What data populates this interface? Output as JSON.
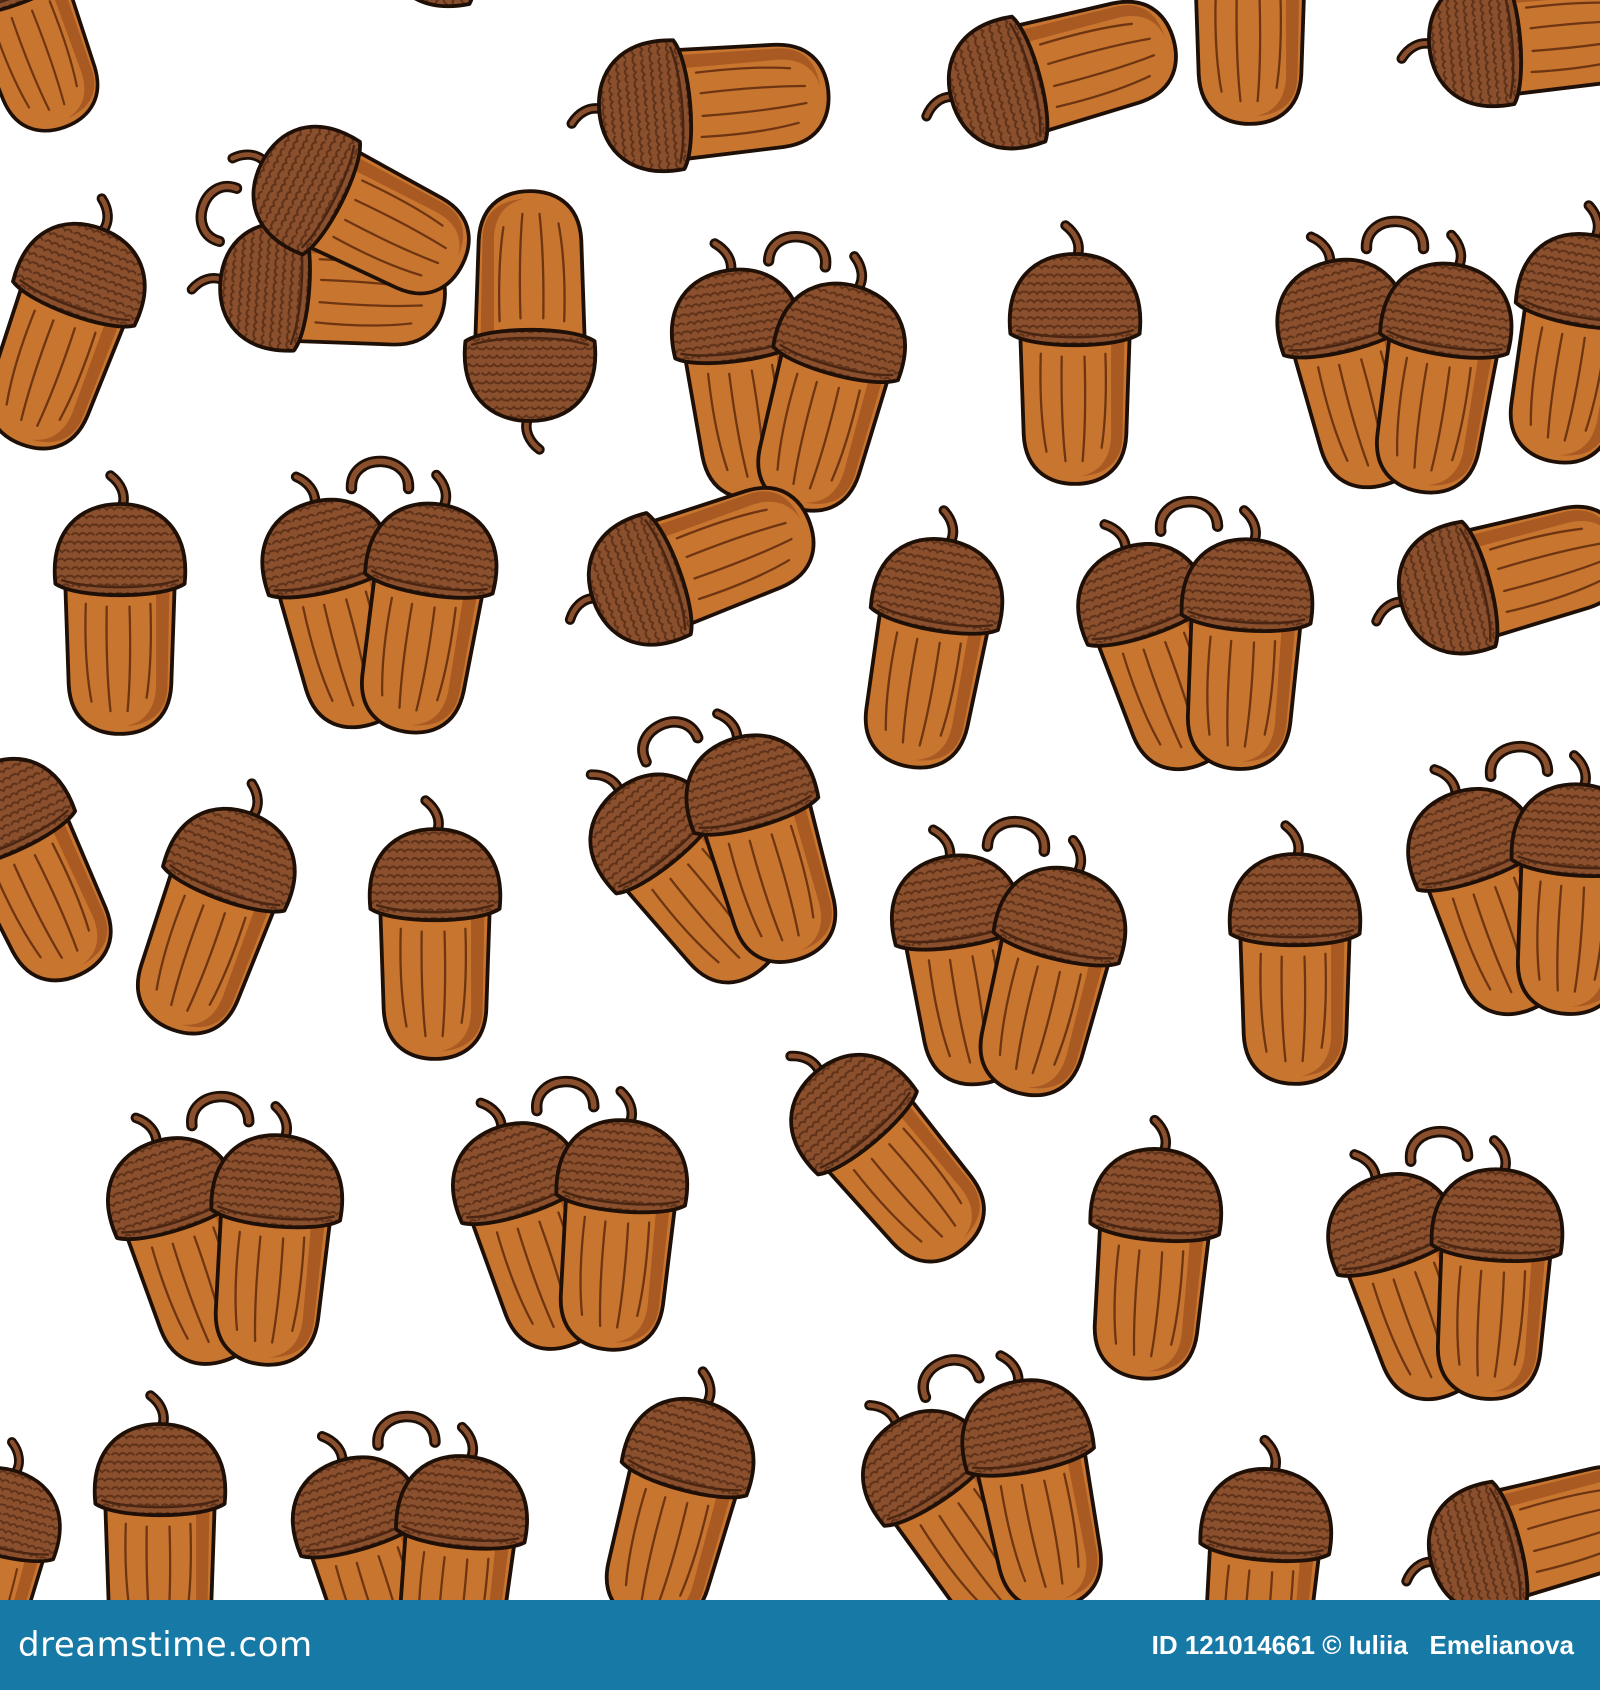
{
  "image": {
    "subject": "seamless pattern of hand-drawn brown acorns",
    "palette": {
      "background": "#ffffff",
      "nut": "#c8752f",
      "nut_shadow": "#a95a22",
      "cap": "#8a4f2c",
      "cap_texture": "#5e3119",
      "outline": "#1e0f07",
      "footer_bar": "#1679a6"
    }
  },
  "footer": {
    "site": "dreamstime.com",
    "credit": "ID 121014661 © Iuliia   Emelianova"
  }
}
